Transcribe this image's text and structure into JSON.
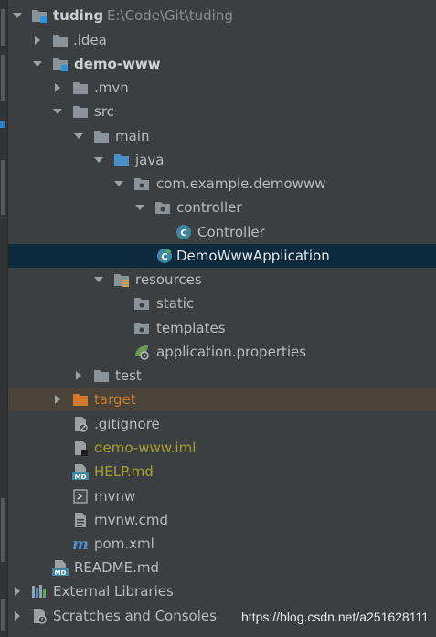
{
  "project_tree": {
    "root": {
      "label": "tuding",
      "path": "E:\\Code\\Git\\tuding"
    },
    "idea": {
      "label": ".idea"
    },
    "module": {
      "label": "demo-www"
    },
    "mvn": {
      "label": ".mvn"
    },
    "src": {
      "label": "src"
    },
    "main": {
      "label": "main"
    },
    "java": {
      "label": "java"
    },
    "package": {
      "label": "com.example.demowww"
    },
    "controller_pkg": {
      "label": "controller"
    },
    "controller_class": {
      "label": "Controller"
    },
    "app_class": {
      "label": "DemoWwwApplication"
    },
    "resources": {
      "label": "resources"
    },
    "static": {
      "label": "static"
    },
    "templates": {
      "label": "templates"
    },
    "app_props": {
      "label": "application.properties"
    },
    "test": {
      "label": "test"
    },
    "target": {
      "label": "target"
    },
    "gitignore": {
      "label": ".gitignore"
    },
    "iml": {
      "label": "demo-www.iml"
    },
    "help": {
      "label": "HELP.md"
    },
    "mvnw": {
      "label": "mvnw"
    },
    "mvnw_cmd": {
      "label": "mvnw.cmd"
    },
    "pom": {
      "label": "pom.xml"
    },
    "readme": {
      "label": "README.md"
    },
    "ext_libs": {
      "label": "External Libraries"
    },
    "scratches": {
      "label": "Scratches and Consoles"
    }
  },
  "icons": {
    "folder": "folder-icon",
    "source_folder": "source-folder-icon",
    "package": "package-icon",
    "class": "class-icon",
    "spring_app": "spring-boot-icon",
    "resources": "resources-folder-icon",
    "excluded_folder": "excluded-folder-icon",
    "module": "module-icon",
    "markdown": "markdown-icon",
    "maven": "maven-icon",
    "libraries": "libraries-icon",
    "scratches": "scratches-icon"
  },
  "colors": {
    "background": "#3c3f41",
    "selection": "#0d293e",
    "excluded_highlight": "#49433a",
    "excluded_text": "#c87d2c",
    "unversioned_text": "#a6a030",
    "folder": "#8a9399",
    "source_folder": "#4a8fc7"
  },
  "watermark": "https://blog.csdn.net/a251628111"
}
